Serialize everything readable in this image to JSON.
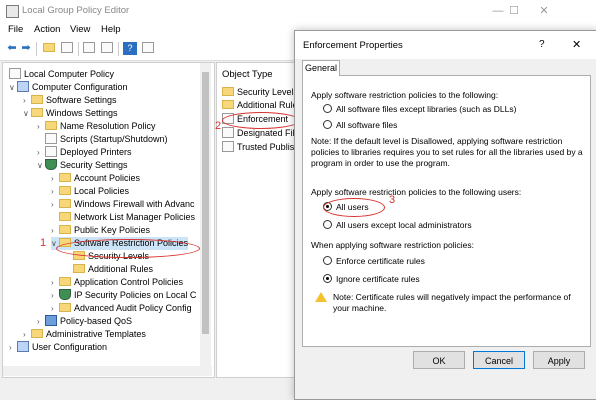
{
  "window": {
    "title": "Local Group Policy Editor"
  },
  "menu": [
    "File",
    "Action",
    "View",
    "Help"
  ],
  "tree": {
    "items": [
      {
        "label": "Local Computer Policy"
      },
      {
        "label": "Computer Configuration"
      },
      {
        "label": "Software Settings"
      },
      {
        "label": "Windows Settings"
      },
      {
        "label": "Name Resolution Policy"
      },
      {
        "label": "Scripts (Startup/Shutdown)"
      },
      {
        "label": "Deployed Printers"
      },
      {
        "label": "Security Settings"
      },
      {
        "label": "Account Policies"
      },
      {
        "label": "Local Policies"
      },
      {
        "label": "Windows Firewall with Advanc"
      },
      {
        "label": "Network List Manager Policies"
      },
      {
        "label": "Public Key Policies"
      },
      {
        "label": "Software Restriction Policies"
      },
      {
        "label": "Security Levels"
      },
      {
        "label": "Additional Rules"
      },
      {
        "label": "Application Control Policies"
      },
      {
        "label": "IP Security Policies on Local C"
      },
      {
        "label": "Advanced Audit Policy Config"
      },
      {
        "label": "Policy-based QoS"
      },
      {
        "label": "Administrative Templates"
      },
      {
        "label": "User Configuration"
      }
    ]
  },
  "list": {
    "header": "Object Type",
    "items": [
      {
        "label": "Security Levels"
      },
      {
        "label": "Additional Rule"
      },
      {
        "label": "Enforcement"
      },
      {
        "label": "Designated File"
      },
      {
        "label": "Trusted Publish"
      }
    ]
  },
  "annotations": {
    "one": "1",
    "two": "2",
    "three": "3"
  },
  "dialog": {
    "title": "Enforcement Properties",
    "help": "?",
    "close": "✕",
    "tab": "General",
    "section1": "Apply software restriction policies to the following:",
    "opt_all_except_libs": "All software files except libraries (such as DLLs)",
    "opt_all_files": "All software files",
    "note1": "Note:  If the default level is Disallowed, applying software restriction policies to libraries requires you to set rules for all the libraries used by a program in order to use the program.",
    "section2": "Apply software restriction policies to the following users:",
    "opt_all_users": "All users",
    "opt_all_except_admins": "All users except local administrators",
    "section3": "When applying software restriction policies:",
    "opt_enforce": "Enforce certificate rules",
    "opt_ignore": "Ignore certificate rules",
    "note2": "Note:  Certificate rules will negatively impact the performance of your machine.",
    "ok": "OK",
    "cancel": "Cancel",
    "apply": "Apply"
  },
  "colors": {
    "accent": "#0078d7",
    "annotation": "#d8332f",
    "selection": "#cce4f7"
  }
}
